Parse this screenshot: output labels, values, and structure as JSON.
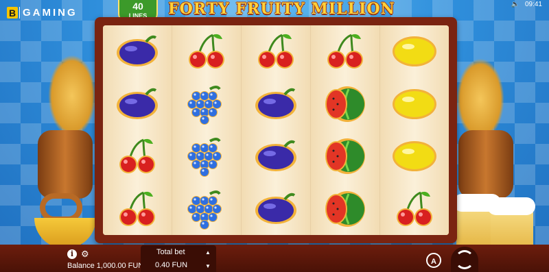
{
  "header": {
    "brand": "B",
    "brand_rest": "GAMING",
    "lines_count": "40",
    "lines_label": "LINES",
    "title": "FORTY FRUITY MILLION",
    "time": "09:41",
    "sound_icon": "speaker-icon"
  },
  "reels": [
    [
      "plum",
      "plum",
      "cherry",
      "cherry"
    ],
    [
      "cherry",
      "grapes",
      "grapes",
      "grapes"
    ],
    [
      "cherry",
      "plum",
      "plum",
      "plum"
    ],
    [
      "cherry",
      "watermelon",
      "watermelon",
      "watermelon"
    ],
    [
      "lemon",
      "lemon",
      "lemon",
      "cherry"
    ]
  ],
  "colors": {
    "frame": "#7a2411",
    "reel_bg": "#f5e5c6",
    "title": "#ffd23b",
    "plum": "#3a2aa8",
    "cherry": "#d8201f",
    "grapes": "#2f6fe0",
    "lemon": "#f2dc14",
    "watermelon": "#2e8b2a"
  },
  "footer": {
    "info_icon": "info-icon",
    "settings_icon": "gear-icon",
    "balance_label": "Balance 1,000.00 FUN",
    "total_bet_label": "Total bet",
    "total_bet_value": "0.40 FUN",
    "autoplay_label": "A",
    "spin_icon": "spin-icon"
  }
}
